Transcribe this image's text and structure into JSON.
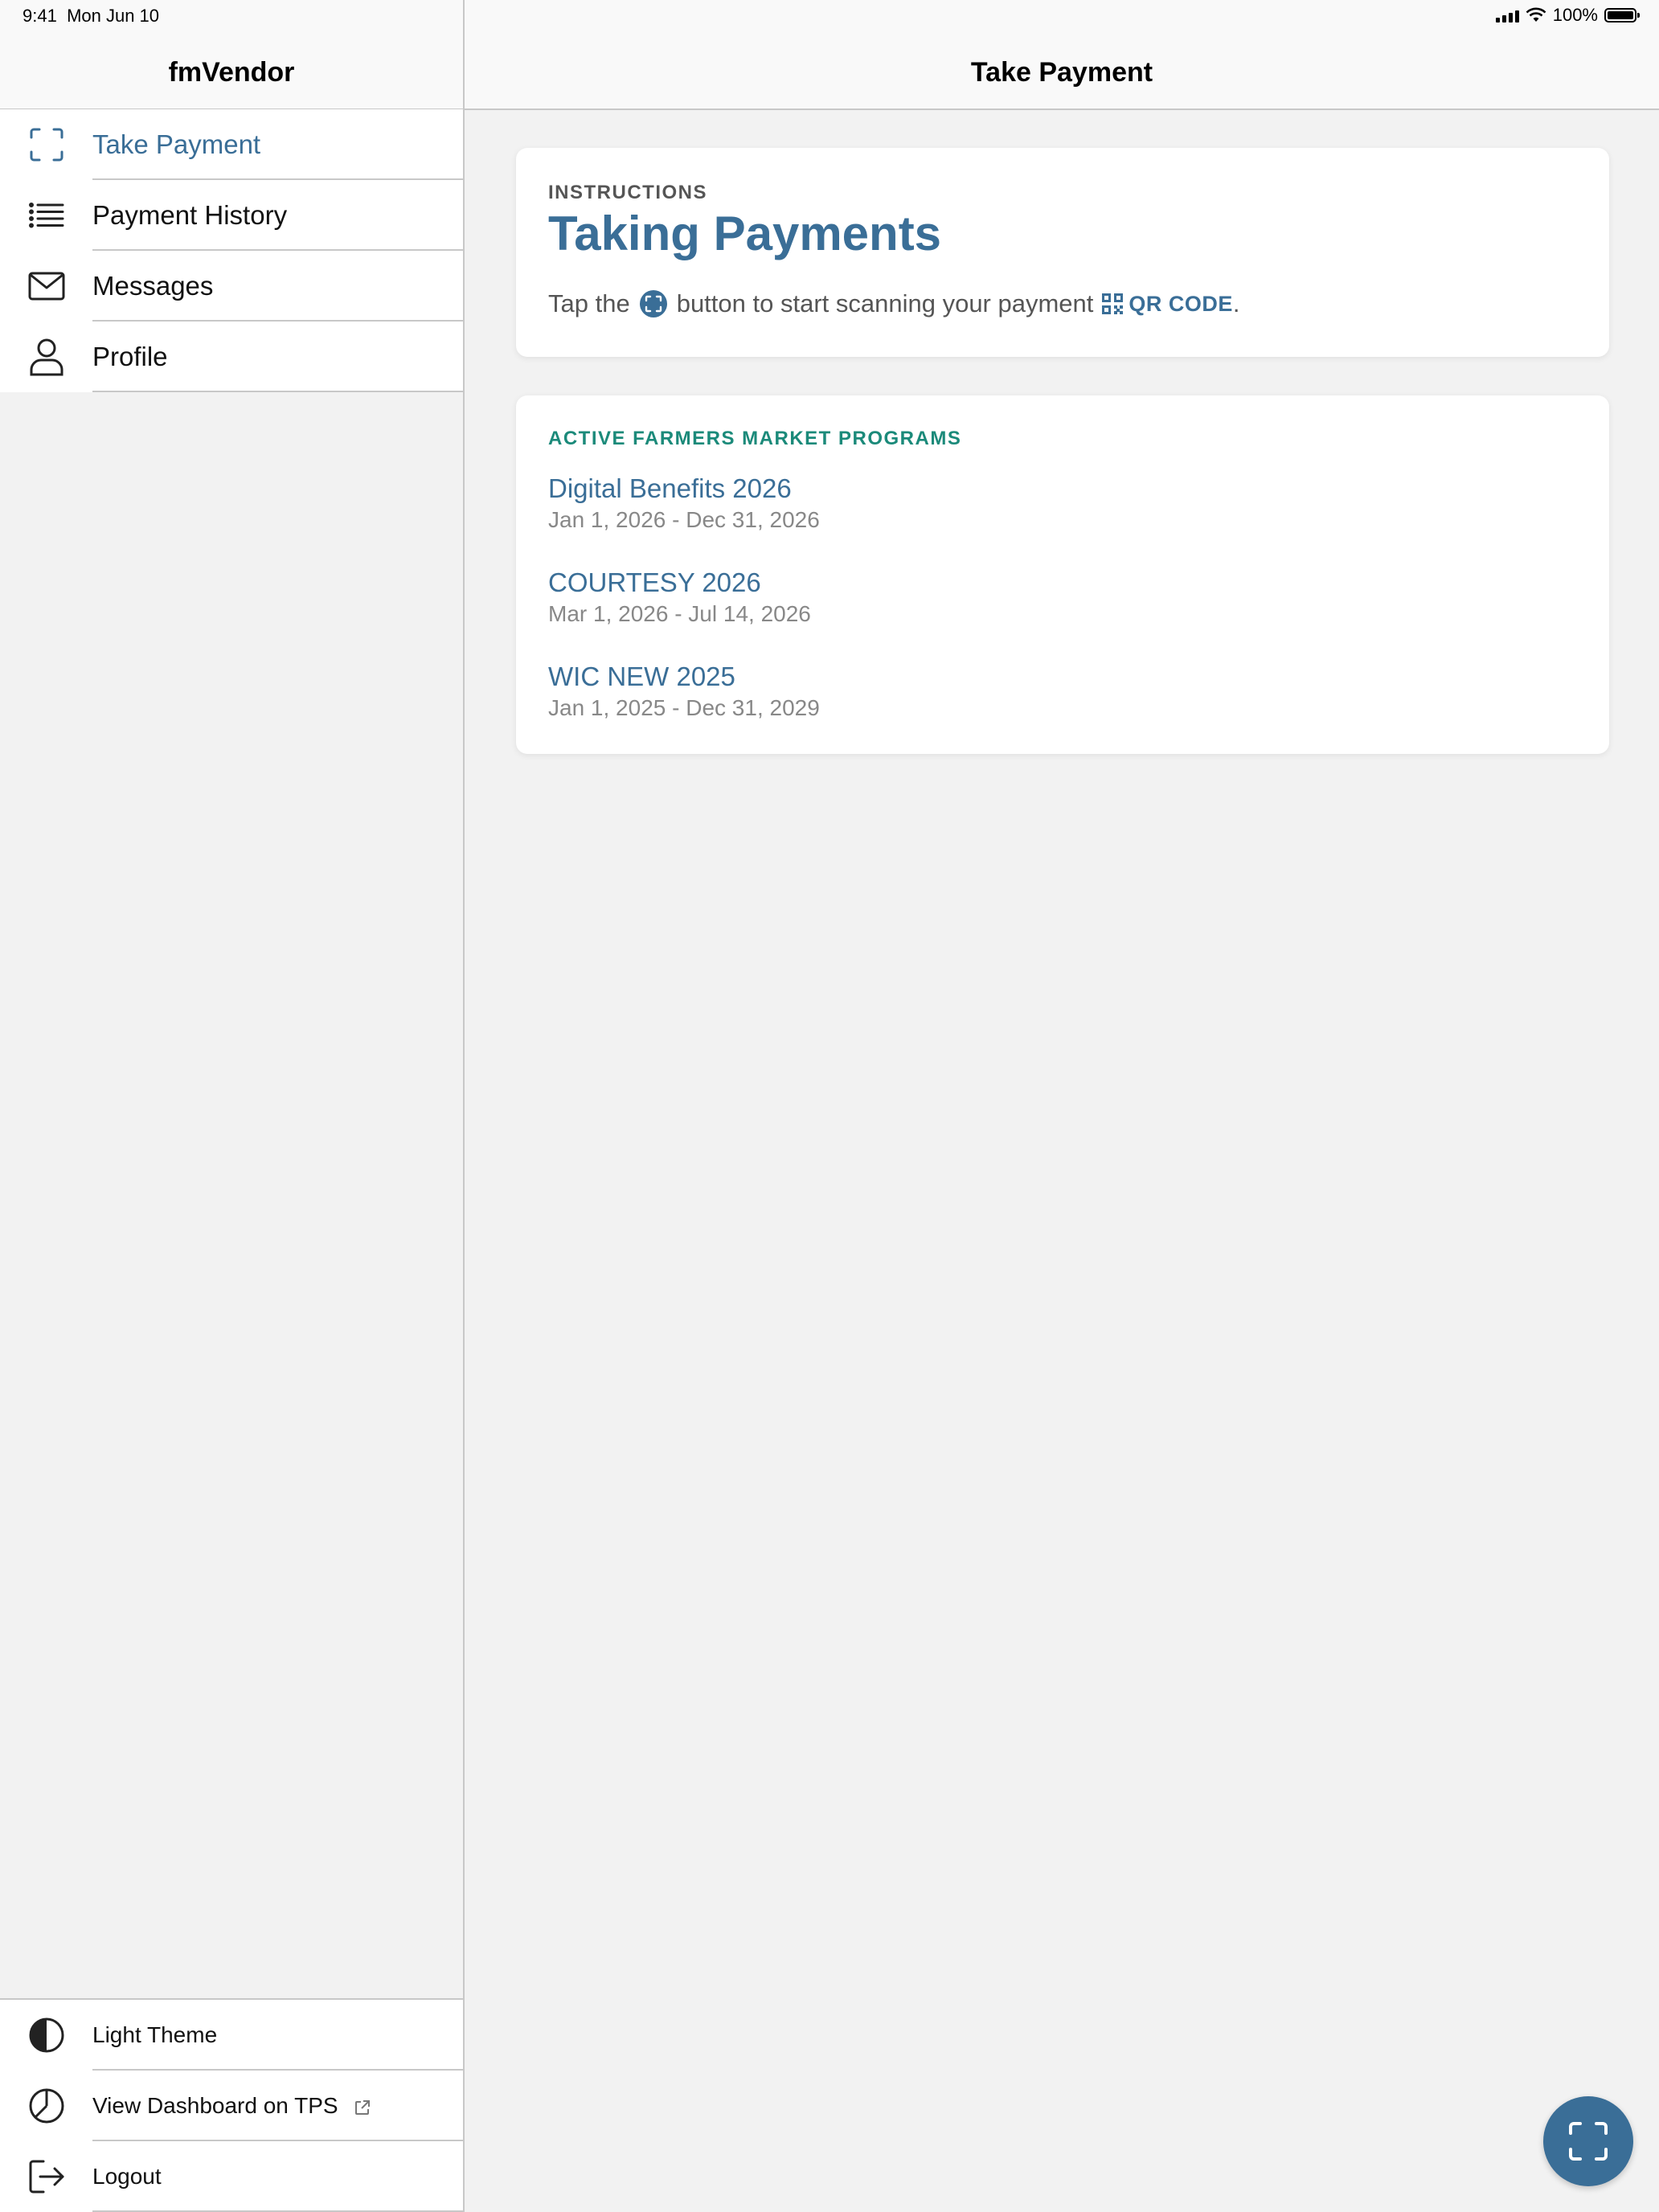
{
  "status_bar": {
    "time": "9:41",
    "date": "Mon Jun 10",
    "battery": "100%"
  },
  "sidebar": {
    "title": "fmVendor",
    "items": [
      {
        "label": "Take Payment",
        "icon": "scan-icon",
        "active": true
      },
      {
        "label": "Payment History",
        "icon": "list-icon"
      },
      {
        "label": "Messages",
        "icon": "envelope-icon"
      },
      {
        "label": "Profile",
        "icon": "person-icon"
      }
    ],
    "bottom_items": [
      {
        "label": "Light Theme",
        "icon": "contrast-icon"
      },
      {
        "label": "View Dashboard on TPS",
        "icon": "pie-chart-icon",
        "external": true
      },
      {
        "label": "Logout",
        "icon": "logout-icon"
      }
    ]
  },
  "main": {
    "title": "Take Payment",
    "instructions": {
      "eyebrow": "INSTRUCTIONS",
      "heading": "Taking Payments",
      "text_before": "Tap the",
      "text_middle": "button to start scanning your payment",
      "qr_label": "QR CODE",
      "text_after": "."
    },
    "programs": {
      "title": "ACTIVE FARMERS MARKET PROGRAMS",
      "items": [
        {
          "name": "Digital Benefits 2026",
          "dates": "Jan 1, 2026 - Dec 31, 2026"
        },
        {
          "name": "COURTESY 2026",
          "dates": "Mar 1, 2026 - Jul 14, 2026"
        },
        {
          "name": "WIC NEW 2025",
          "dates": "Jan 1, 2025 - Dec 31, 2029"
        }
      ]
    }
  },
  "colors": {
    "accent": "#3a6e97",
    "teal": "#1b8a7a",
    "background": "#f2f2f2"
  }
}
